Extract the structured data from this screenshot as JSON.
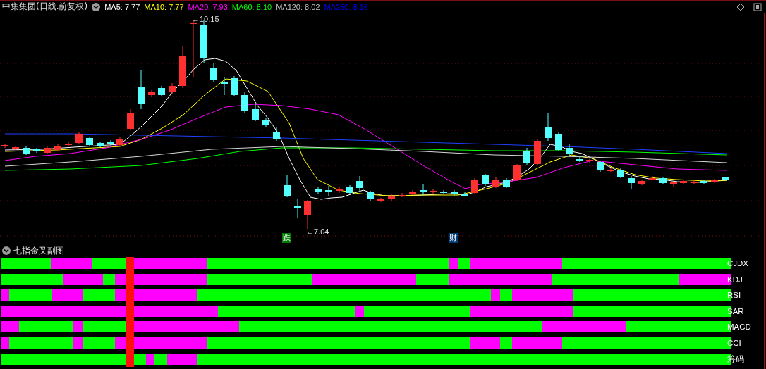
{
  "header": {
    "title": "中集集团(日线.前复权)",
    "ma_values": [
      {
        "label": "MA5: 7.77",
        "color": "#ffffff"
      },
      {
        "label": "MA10: 7.77",
        "color": "#ffff00"
      },
      {
        "label": "MA20: 7.93",
        "color": "#ff00ff"
      },
      {
        "label": "MA60: 8.10",
        "color": "#00ff00"
      },
      {
        "label": "MA120: 8.02",
        "color": "#c0c0c0"
      },
      {
        "label": "MA250: 8.16",
        "color": "#0000ff"
      }
    ]
  },
  "chart": {
    "high_label": "←10.15",
    "low_label": "←7.04",
    "markers": [
      {
        "text": "跌",
        "color": "#007a00"
      },
      {
        "text": "财",
        "color": "#003c78"
      }
    ]
  },
  "subchart": {
    "title": "七指金叉副图",
    "strips": [
      {
        "label": "CJDX"
      },
      {
        "label": "KDJ"
      },
      {
        "label": "RSI"
      },
      {
        "label": "SAR"
      },
      {
        "label": "MACD"
      },
      {
        "label": "CCI"
      },
      {
        "label": "筹码"
      }
    ]
  }
}
